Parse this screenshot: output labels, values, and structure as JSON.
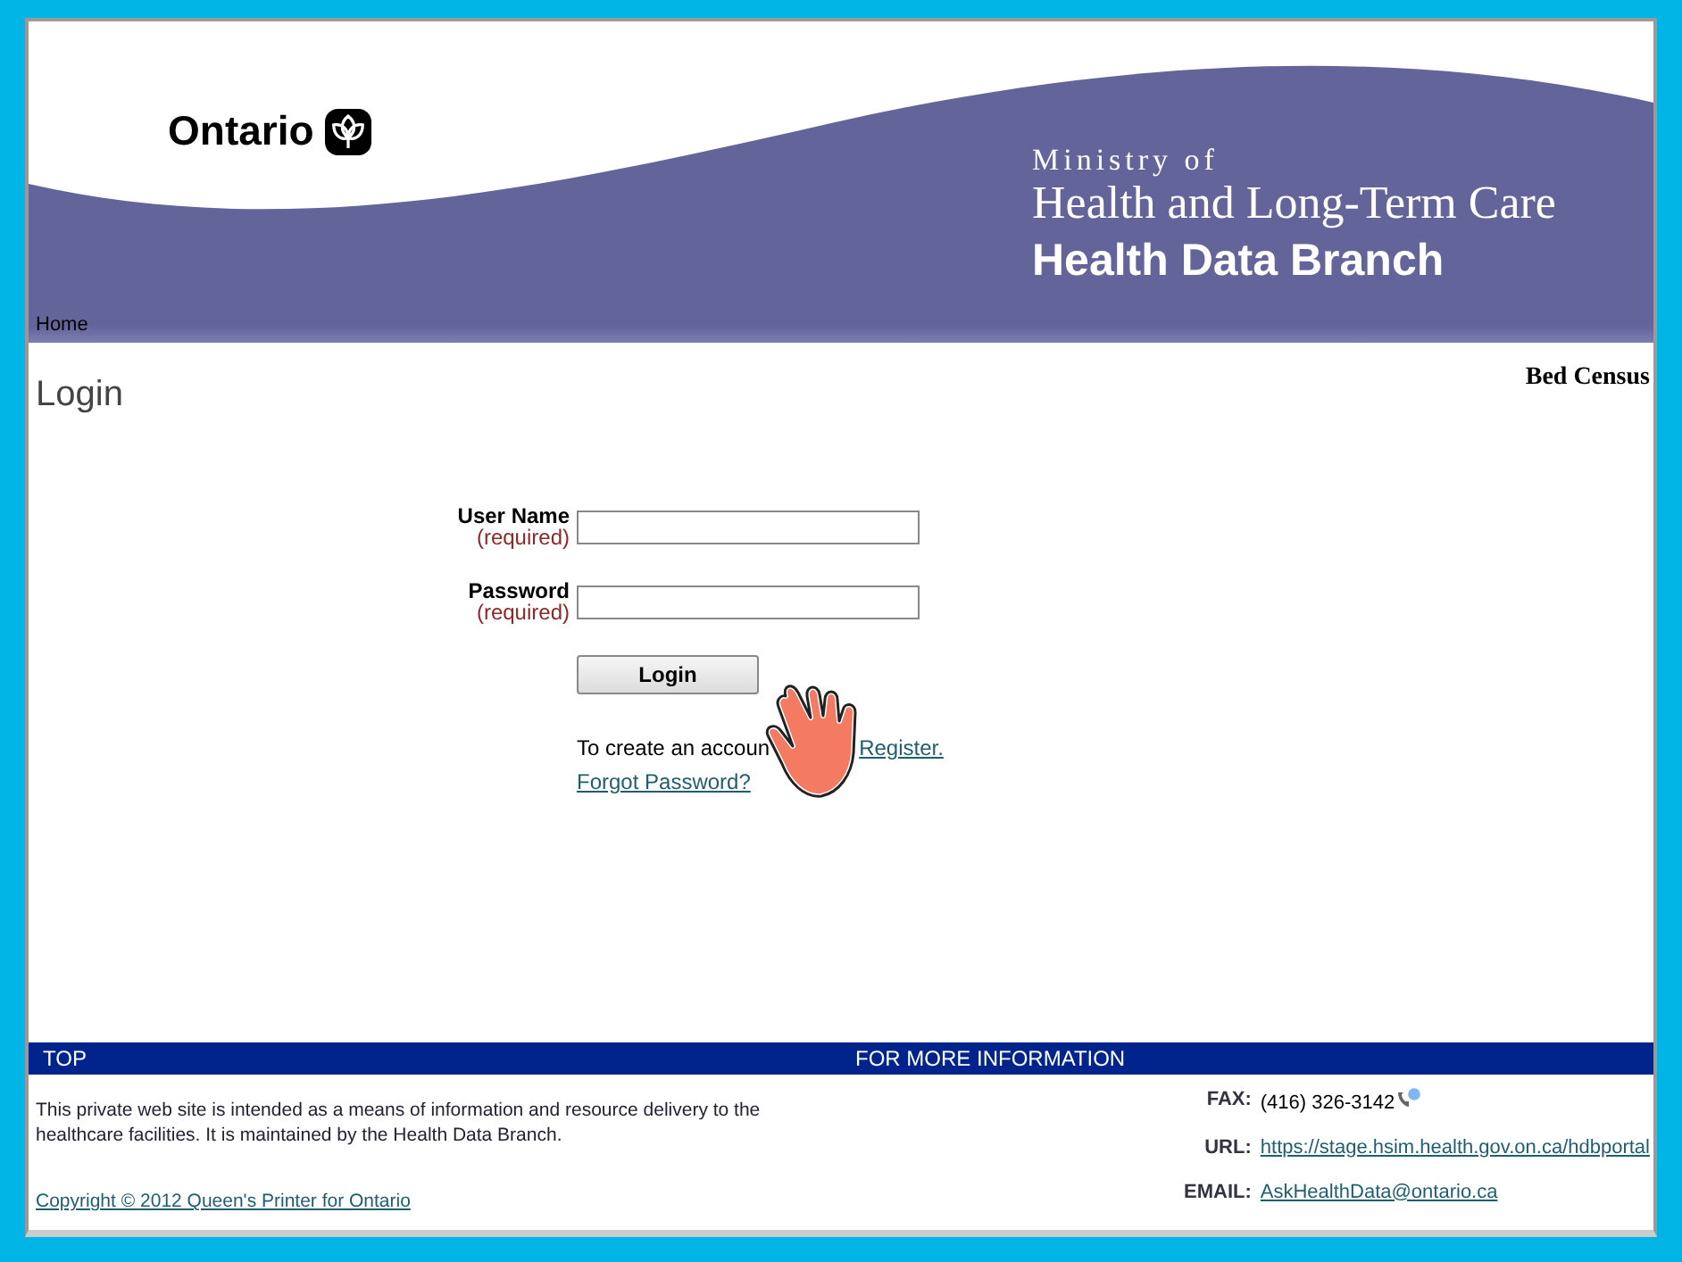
{
  "header": {
    "logo_text": "Ontario",
    "ministry_line": "Ministry of",
    "ministry_name": "Health and Long-Term Care",
    "branch": "Health Data Branch"
  },
  "nav": {
    "items": [
      {
        "label": "Home"
      }
    ]
  },
  "page": {
    "title": "Login",
    "app_name": "Bed Census"
  },
  "form": {
    "fields": [
      {
        "label": "User Name",
        "note": "(required)"
      },
      {
        "label": "Password",
        "note": "(required)"
      }
    ],
    "button": "Login",
    "register_text": "To create an accoun",
    "register_link": "Register.",
    "forgot_link": "Forgot Password?"
  },
  "footer": {
    "left_heading": "TOP",
    "right_heading": "FOR MORE INFORMATION",
    "notice": "This private web site is intended as a means of information and resource delivery to the healthcare facilities. It is maintained by the Health Data Branch.",
    "contacts": [
      {
        "label": "FAX:",
        "value": "(416) 326-3142",
        "kind": "phone"
      },
      {
        "label": "URL:",
        "value": "https://stage.hsim.health.gov.on.ca/hdbportal",
        "kind": "link"
      },
      {
        "label": "EMAIL:",
        "value": "AskHealthData@ontario.ca",
        "kind": "link"
      }
    ],
    "copyright": "Copyright © 2012 Queen's Printer for Ontario"
  }
}
